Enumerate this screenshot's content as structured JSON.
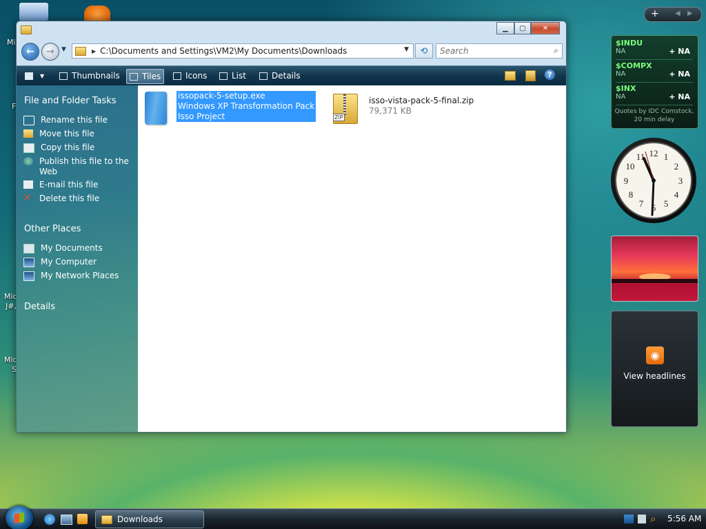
{
  "colors": {
    "accent": "#3399ff",
    "toolbar": "#12364d",
    "task_pane": "#2e7b8c"
  },
  "desktop_fragments": [
    "Mi",
    "F",
    "Mic",
    "J#,",
    "Mic",
    "S"
  ],
  "window": {
    "address": "C:\\Documents and Settings\\VM2\\My Documents\\Downloads",
    "search_placeholder": "Search",
    "toolbar": {
      "views": [
        {
          "label": "Thumbnails"
        },
        {
          "label": "Tiles"
        },
        {
          "label": "Icons"
        },
        {
          "label": "List"
        },
        {
          "label": "Details"
        }
      ]
    },
    "task_pane": {
      "file_folder_tasks": "File and Folder Tasks",
      "tasks": [
        "Rename this file",
        "Move this file",
        "Copy this file",
        "Publish this file to the",
        "Web",
        "E-mail this file",
        "Delete this file"
      ],
      "other_places": "Other Places",
      "places": [
        "My Documents",
        "My Computer",
        "My Network Places"
      ],
      "details": "Details"
    },
    "files": [
      {
        "name": "issopack-5-setup.exe",
        "line2": "Windows XP Transformation Pack",
        "line3": "Isso Project"
      },
      {
        "name": "isso-vista-pack-5-final.zip",
        "line2": "79,371 KB",
        "type_badge": "ZIP"
      }
    ]
  },
  "gadgets": {
    "stocks": [
      {
        "symbol": "$INDU",
        "value": "NA",
        "change": "+ NA"
      },
      {
        "symbol": "$COMPX",
        "value": "NA",
        "change": "+ NA"
      },
      {
        "symbol": "$INX",
        "value": "NA",
        "change": "+ NA"
      }
    ],
    "stocks_footer": "Quotes by IDC Comstock, 20 min delay",
    "feed_label": "View headlines"
  },
  "taskbar": {
    "task_label": "Downloads",
    "time": "5:56 AM"
  }
}
